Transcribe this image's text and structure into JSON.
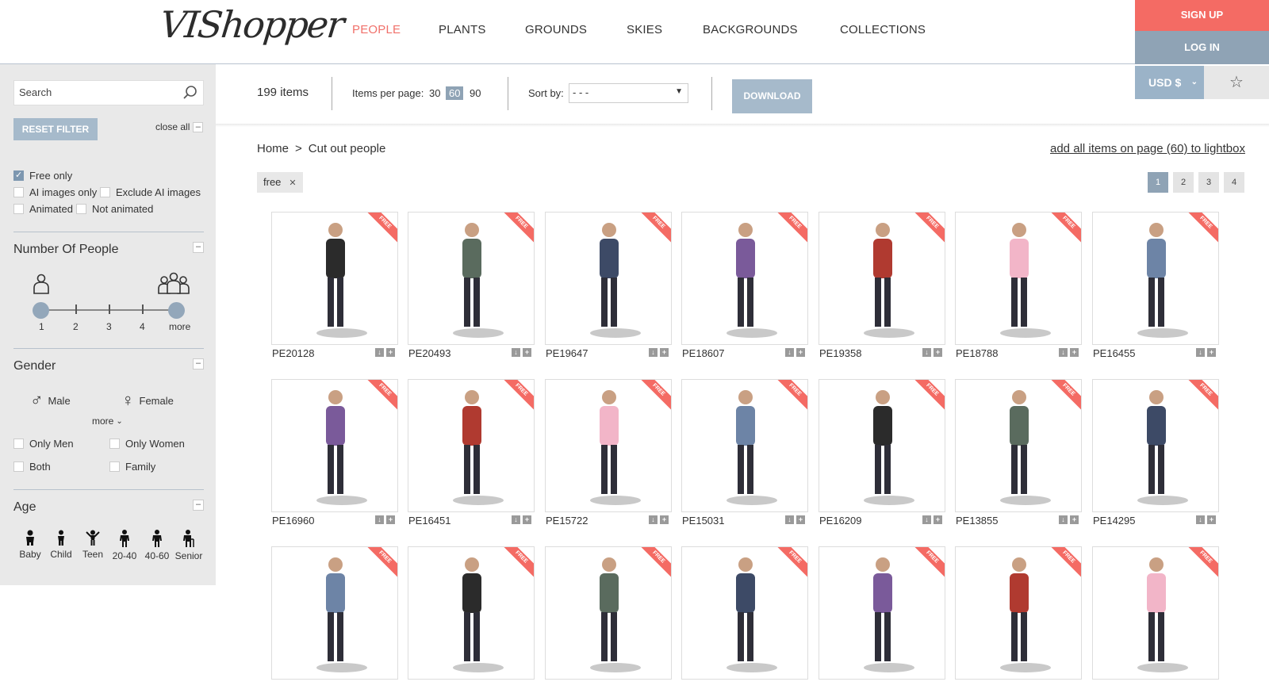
{
  "header": {
    "logo": "VIShopper",
    "nav": [
      "PEOPLE",
      "PLANTS",
      "GROUNDS",
      "SKIES",
      "BACKGROUNDS",
      "COLLECTIONS"
    ],
    "sign_up": "SIGN UP",
    "log_in": "LOG IN",
    "currency": "USD $",
    "icons": {
      "lightbox": "star-icon",
      "currency_dropdown": "chevron-down-icon"
    }
  },
  "sidebar": {
    "search_placeholder": "Search",
    "reset_filter": "RESET FILTER",
    "close_all": "close all",
    "filters": {
      "free_only": "Free only",
      "ai_only": "AI images only",
      "exclude_ai": "Exclude AI images",
      "animated": "Animated",
      "not_animated": "Not animated"
    },
    "number_of_people": {
      "title": "Number Of People",
      "labels": [
        "1",
        "2",
        "3",
        "4",
        "more"
      ]
    },
    "gender": {
      "title": "Gender",
      "male": "Male",
      "female": "Female",
      "more": "more",
      "only_men": "Only Men",
      "only_women": "Only Women",
      "both": "Both",
      "family": "Family"
    },
    "age": {
      "title": "Age",
      "labels": [
        "Baby",
        "Child",
        "Teen",
        "20-40",
        "40-60",
        "Senior"
      ]
    }
  },
  "toolbar": {
    "items_count": "199 items",
    "items_per_page_label": "Items per page:",
    "ipp_options": [
      "30",
      "60",
      "90"
    ],
    "sort_by_label": "Sort by:",
    "sort_value": "- - -",
    "download": "DOWNLOAD"
  },
  "content": {
    "breadcrumb_home": "Home",
    "breadcrumb_sep": ">",
    "breadcrumb_current": "Cut out people",
    "lightbox_link": "add all items on page (60) to lightbox",
    "tag": "free",
    "pages": [
      "1",
      "2",
      "3",
      "4"
    ],
    "ribbon": "FREE",
    "row1": [
      "PE20128",
      "PE20493",
      "PE19647",
      "PE18607",
      "PE19358",
      "PE18788",
      "PE16455"
    ],
    "row2": [
      "PE16960",
      "PE16451",
      "PE15722",
      "PE15031",
      "PE16209",
      "PE13855",
      "PE14295"
    ]
  },
  "colors": {
    "accent": "#f0706a",
    "slate": "#8fa3b5",
    "sidebar_bg": "#e9e9e9"
  }
}
